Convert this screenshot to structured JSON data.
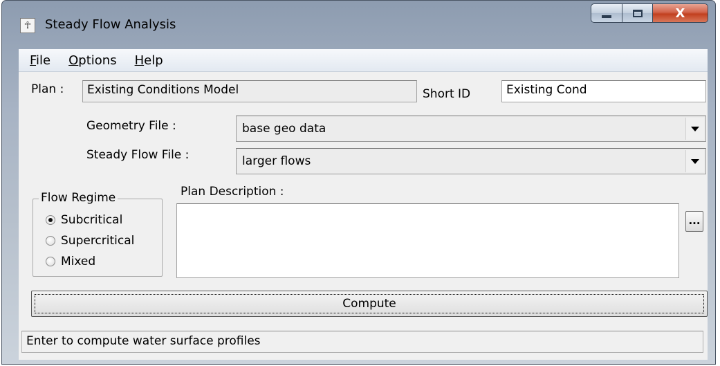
{
  "window": {
    "title": "Steady Flow Analysis",
    "app_icon": "hec-ras-app-icon",
    "controls": {
      "minimize": "minimize-icon",
      "maximize": "maximize-icon",
      "close": "X"
    }
  },
  "menu": {
    "items": [
      {
        "label": "File",
        "mnemonic": "F",
        "rest": "ile"
      },
      {
        "label": "Options",
        "mnemonic": "O",
        "rest": "ptions"
      },
      {
        "label": "Help",
        "mnemonic": "H",
        "rest": "elp"
      }
    ]
  },
  "plan": {
    "label": "Plan :",
    "value": "Existing Conditions Model",
    "short_id_label": "Short ID",
    "short_id_value": "Existing Cond"
  },
  "geometry": {
    "label": "Geometry File :",
    "value": "base geo data"
  },
  "steady_flow": {
    "label": "Steady Flow File :",
    "value": "larger flows"
  },
  "flow_regime": {
    "title": "Flow Regime",
    "options": [
      "Subcritical",
      "Supercritical",
      "Mixed"
    ],
    "selected": "Subcritical"
  },
  "description": {
    "label": "Plan Description :",
    "value": "",
    "browse_label": "..."
  },
  "compute": {
    "label": "Compute"
  },
  "status": {
    "text": "Enter to compute water surface profiles"
  }
}
